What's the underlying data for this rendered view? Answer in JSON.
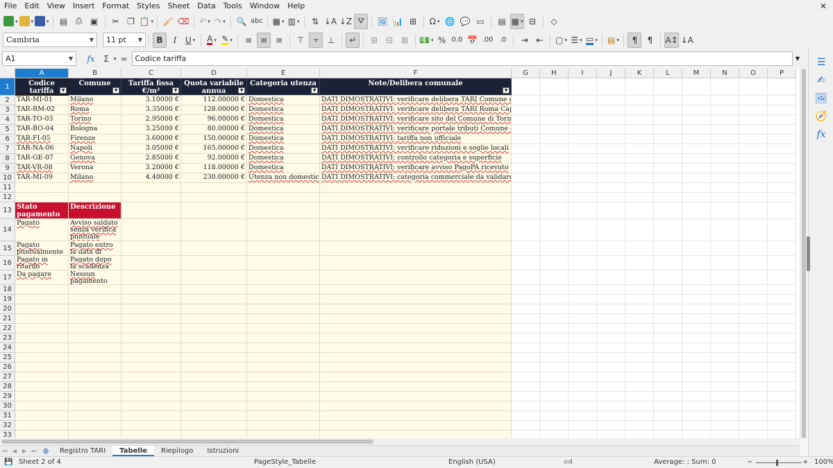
{
  "menubar": [
    "File",
    "Edit",
    "View",
    "Insert",
    "Format",
    "Styles",
    "Sheet",
    "Data",
    "Tools",
    "Window",
    "Help"
  ],
  "font": {
    "name": "Cambria",
    "size": "11 pt"
  },
  "formula": {
    "cell_ref": "A1",
    "content": "Codice tariffa",
    "fx_icon": "fx",
    "sum_icon": "Σ",
    "eq_icon": "="
  },
  "columns": [
    "A",
    "B",
    "C",
    "D",
    "E",
    "F",
    "G",
    "H",
    "I",
    "J",
    "K",
    "L",
    "M",
    "N",
    "O",
    "P"
  ],
  "rows": [
    "1",
    "2",
    "3",
    "4",
    "5",
    "6",
    "7",
    "8",
    "9",
    "10",
    "11",
    "12",
    "13",
    "14",
    "15",
    "16",
    "17",
    "18",
    "19",
    "20",
    "21",
    "22",
    "23",
    "24",
    "25",
    "26",
    "27",
    "28",
    "29",
    "30",
    "31",
    "32",
    "33"
  ],
  "table_headers": [
    "Codice tariffa",
    "Comune",
    "Tariffa fissa €/m²",
    "Quota variabile annua",
    "Categoria utenza",
    "Note/Delibera comunale"
  ],
  "table_rows": [
    [
      "TAR-MI-01",
      "Milano",
      "3.10000 €",
      "112.00000 €",
      "Domestica",
      "DATI DIMOSTRATIVI: verificare delibera TARI Comune di Milano"
    ],
    [
      "TAR-RM-02",
      "Roma",
      "3.35000 €",
      "128.00000 €",
      "Domestica",
      "DATI DIMOSTRATIVI: verificare delibera TARI Roma Capitale"
    ],
    [
      "TAR-TO-03",
      "Torino",
      "2.95000 €",
      "96.00000 €",
      "Domestica",
      "DATI DIMOSTRATIVI: verificare sito del Comune di Torino"
    ],
    [
      "TAR-BO-04",
      "Bologna",
      "3.25000 €",
      "80.00000 €",
      "Domestica",
      "DATI DIMOSTRATIVI: verificare portale tributi Comune di Bologna"
    ],
    [
      "TAR-FI-05",
      "Firenze",
      "3.60000 €",
      "150.00000 €",
      "Domestica",
      "DATI DIMOSTRATIVI: tariffa non ufficiale"
    ],
    [
      "TAR-NA-06",
      "Napoli",
      "3.05000 €",
      "165.00000 €",
      "Domestica",
      "DATI DIMOSTRATIVI: verificare riduzioni e soglie locali"
    ],
    [
      "TAR-GE-07",
      "Genova",
      "2.85000 €",
      "92.00000 €",
      "Domestica",
      "DATI DIMOSTRATIVI: controllo categoria e superficie"
    ],
    [
      "TAR-VR-08",
      "Verona",
      "3.20000 €",
      "118.00000 €",
      "Domestica",
      "DATI DIMOSTRATIVI: verificare avviso PagoPA ricevuto"
    ],
    [
      "TAR-MI-09",
      "Milano",
      "4.40000 €",
      "230.00000 €",
      "Utenza non domestica",
      "DATI DIMOSTRATIVI: categoria commerciale da validare"
    ]
  ],
  "status_table": {
    "headers": [
      "Stato pagamento",
      "Descrizione"
    ],
    "rows": [
      [
        "Pagato",
        "Avviso saldato senza verifica puntuale"
      ],
      [
        "Pagato puntualmente",
        "Pagato entro la data di scadenza"
      ],
      [
        "Pagato in ritardo",
        "Pagato dopo la scadenza"
      ],
      [
        "Da pagare",
        "Nessun pagamento registrato"
      ]
    ]
  },
  "tabs": [
    "Registro TARI",
    "Tabelle",
    "Riepilogo",
    "Istruzioni"
  ],
  "active_tab": "Tabelle",
  "status": {
    "sheet": "Sheet 2 of 4",
    "page_style": "PageStyle_Tabelle",
    "language": "English (USA)",
    "summary": "Average: ; Sum: 0",
    "zoom": "100%"
  },
  "colors": {
    "header_bg": "#1c2235",
    "status_header_bg": "#c8102e",
    "cell_bg": "#fffbe8",
    "selection": "#1f7dcf"
  }
}
